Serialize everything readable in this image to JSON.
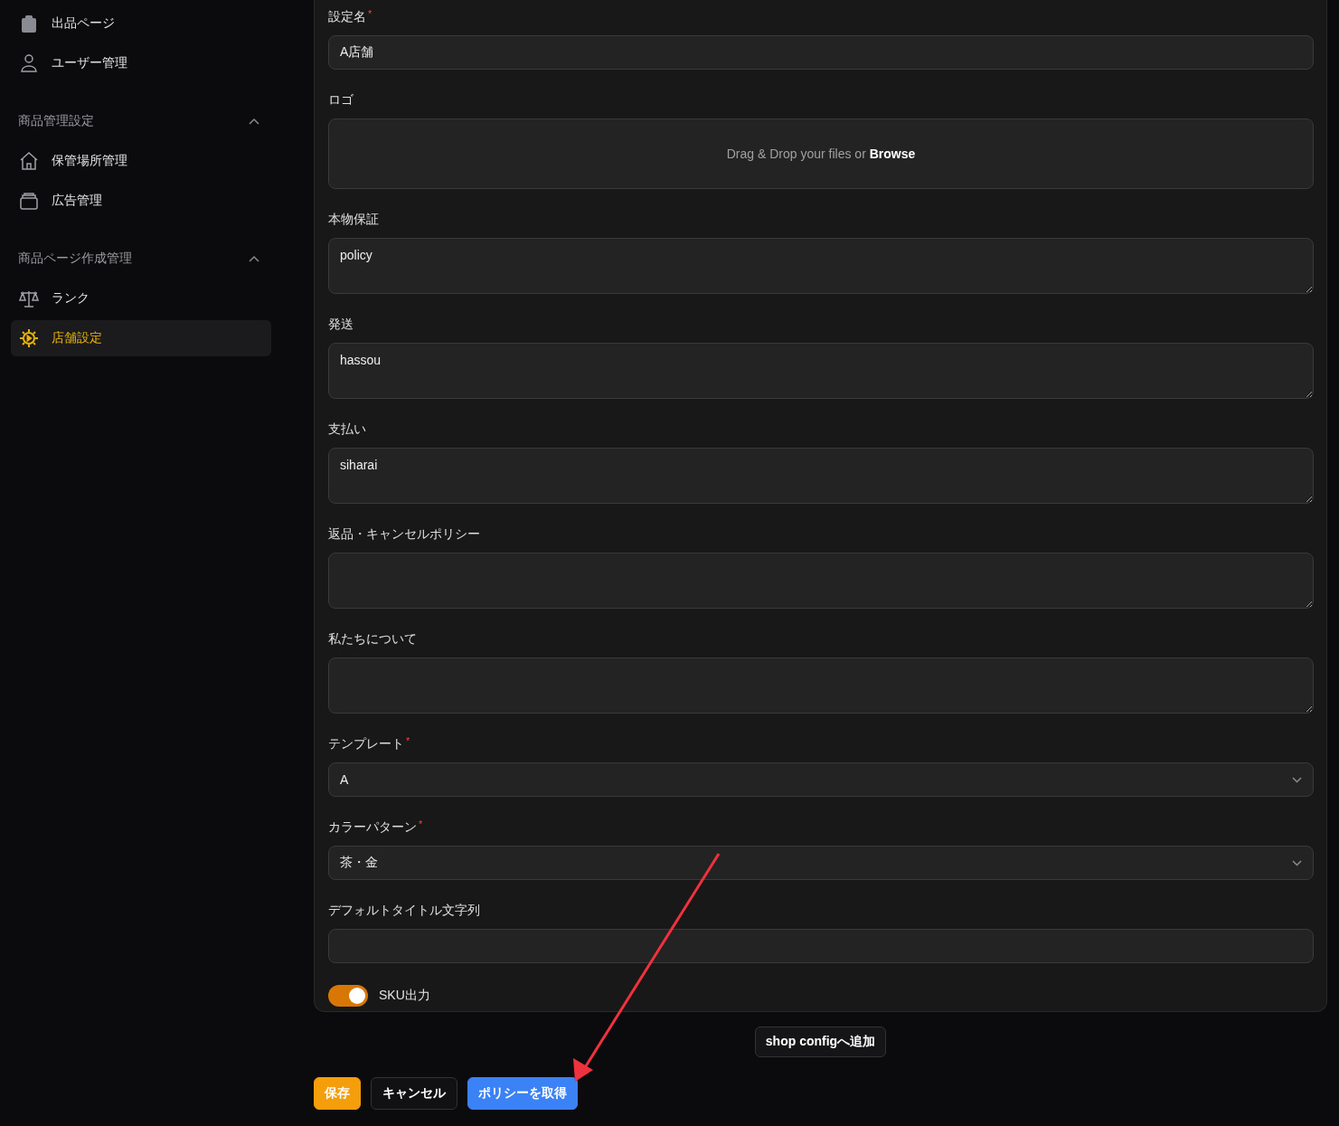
{
  "sidebar": {
    "items": [
      {
        "label": "出品ページ",
        "selected": false
      },
      {
        "label": "ユーザー管理",
        "selected": false
      }
    ],
    "sections": [
      {
        "title": "商品管理設定",
        "expanded": true,
        "items": [
          {
            "label": "保管場所管理",
            "selected": false
          },
          {
            "label": "広告管理",
            "selected": false
          }
        ]
      },
      {
        "title": "商品ページ作成管理",
        "expanded": true,
        "items": [
          {
            "label": "ランク",
            "selected": false
          },
          {
            "label": "店舗設定",
            "selected": true
          }
        ]
      }
    ]
  },
  "form": {
    "fields": [
      {
        "kind": "text",
        "label": "設定名",
        "required_mark": "*",
        "value": "A店舗"
      },
      {
        "kind": "dropzone",
        "label": "ロゴ",
        "prompt": "Drag & Drop your files or **Browse**"
      },
      {
        "kind": "textarea",
        "label": "本物保証",
        "value": "policy"
      },
      {
        "kind": "textarea",
        "label": "発送",
        "value": "hassou"
      },
      {
        "kind": "textarea",
        "label": "支払い",
        "value": "siharai"
      },
      {
        "kind": "textarea",
        "label": "返品・キャンセルポリシー"
      },
      {
        "kind": "textarea",
        "label": "私たちについて"
      },
      {
        "kind": "select",
        "label": "テンプレート",
        "required_mark": "*",
        "value": "A"
      },
      {
        "kind": "select",
        "label": "カラーパターン",
        "required_mark": "*",
        "value": "茶・金"
      },
      {
        "kind": "text",
        "label": "デフォルトタイトル文字列"
      },
      {
        "kind": "toggle",
        "label": "SKU出力",
        "on": true
      }
    ]
  },
  "shop_config_button": "shop configへ追加",
  "footer_buttons": [
    {
      "kind": "primary",
      "label": "保存"
    },
    {
      "kind": "secondary",
      "label": "キャンセル"
    },
    {
      "kind": "accent",
      "label": "ポリシーを取得"
    }
  ]
}
